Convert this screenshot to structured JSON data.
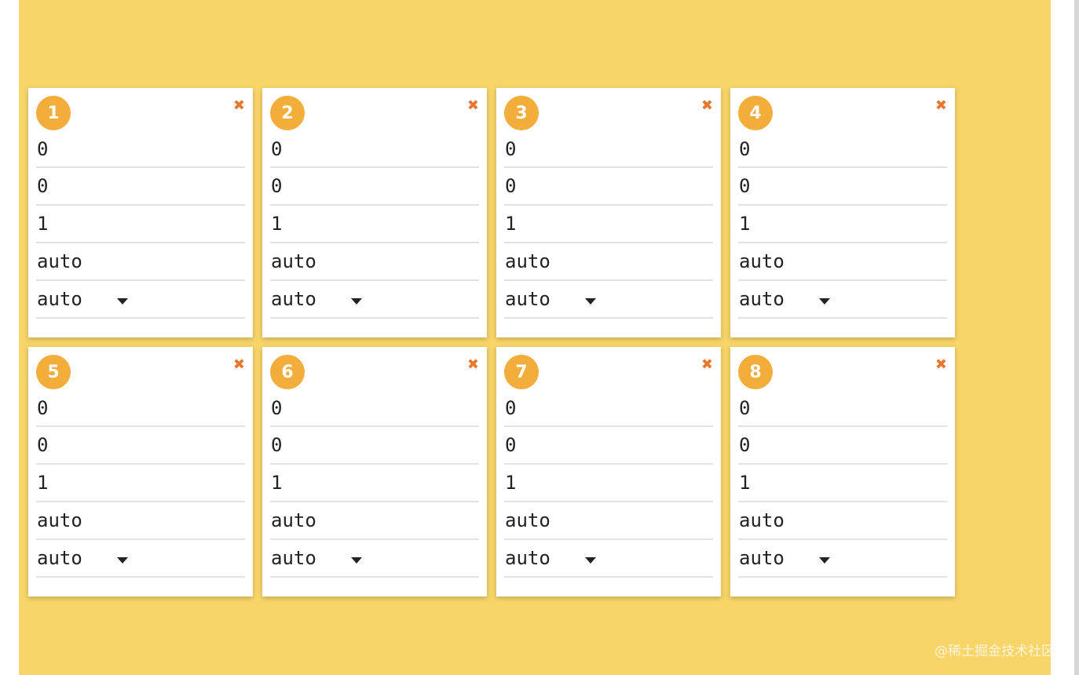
{
  "cards": [
    {
      "number": "1",
      "close": "✖",
      "fields": [
        "0",
        "0",
        "1",
        "auto"
      ],
      "select": "auto"
    },
    {
      "number": "2",
      "close": "✖",
      "fields": [
        "0",
        "0",
        "1",
        "auto"
      ],
      "select": "auto"
    },
    {
      "number": "3",
      "close": "✖",
      "fields": [
        "0",
        "0",
        "1",
        "auto"
      ],
      "select": "auto"
    },
    {
      "number": "4",
      "close": "✖",
      "fields": [
        "0",
        "0",
        "1",
        "auto"
      ],
      "select": "auto"
    },
    {
      "number": "5",
      "close": "✖",
      "fields": [
        "0",
        "0",
        "1",
        "auto"
      ],
      "select": "auto"
    },
    {
      "number": "6",
      "close": "✖",
      "fields": [
        "0",
        "0",
        "1",
        "auto"
      ],
      "select": "auto"
    },
    {
      "number": "7",
      "close": "✖",
      "fields": [
        "0",
        "0",
        "1",
        "auto"
      ],
      "select": "auto"
    },
    {
      "number": "8",
      "close": "✖",
      "fields": [
        "0",
        "0",
        "1",
        "auto"
      ],
      "select": "auto"
    }
  ],
  "watermark": "@稀土掘金技术社区",
  "colors": {
    "background": "#f8d568",
    "badge": "#f2ad3a",
    "close": "#e8772e"
  },
  "icons": {
    "close": "close-icon",
    "dropdown": "caret-down-icon"
  }
}
